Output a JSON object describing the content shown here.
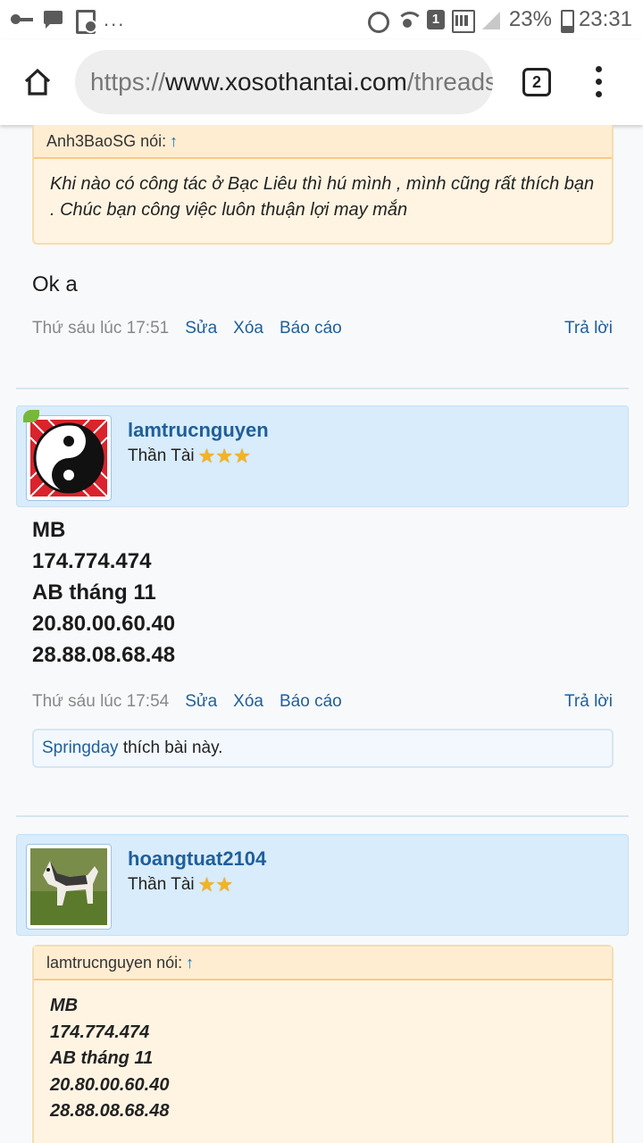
{
  "status_bar": {
    "overflow": "...",
    "sim_slot": "1",
    "battery": "23%",
    "time": "23:31",
    "icons": [
      "key-icon",
      "message-icon",
      "document-icon",
      "alarm-icon",
      "wifi-icon",
      "signal-icon",
      "battery-icon"
    ]
  },
  "browser": {
    "url_scheme": "https://",
    "url_host": "www.xosothantai.com",
    "url_path": "/threads/",
    "tab_count": "2"
  },
  "posts": [
    {
      "quote_author": "Anh3BaoSG nói:",
      "quote_arrow": "↑",
      "quote_text": "Khi nào có công tác ở Bạc Liêu thì hú mình , mình cũng rất thích bạn . Chúc bạn công việc luôn thuận lợi may mắn",
      "message": "Ok a",
      "meta": {
        "date": "Thứ sáu lúc 17:51",
        "edit": "Sửa",
        "delete": "Xóa",
        "report": "Báo cáo",
        "reply": "Trả lời"
      }
    },
    {
      "username": "lamtrucnguyen",
      "user_title": "Thần Tài",
      "stars": 3,
      "message_lines": [
        "MB",
        "174.774.474",
        "AB tháng 11",
        "20.80.00.60.40",
        "28.88.08.68.48"
      ],
      "meta": {
        "date": "Thứ sáu lúc 17:54",
        "edit": "Sửa",
        "delete": "Xóa",
        "report": "Báo cáo",
        "reply": "Trả lời"
      },
      "like": {
        "liker": "Springday",
        "text": " thích bài này."
      }
    },
    {
      "username": "hoangtuat2104",
      "user_title": "Thần Tài",
      "stars": 2,
      "quote_author": "lamtrucnguyen nói:",
      "quote_arrow": "↑",
      "quote_lines": [
        "MB",
        "174.774.474",
        "AB tháng 11",
        "20.80.00.60.40",
        "28.88.08.68.48"
      ]
    }
  ],
  "colors": {
    "link": "#1f5f9a",
    "quote_bg": "#fff4e2",
    "user_card_bg": "#d8ecfb",
    "star": "#f4b320",
    "online": "#76b83a"
  }
}
